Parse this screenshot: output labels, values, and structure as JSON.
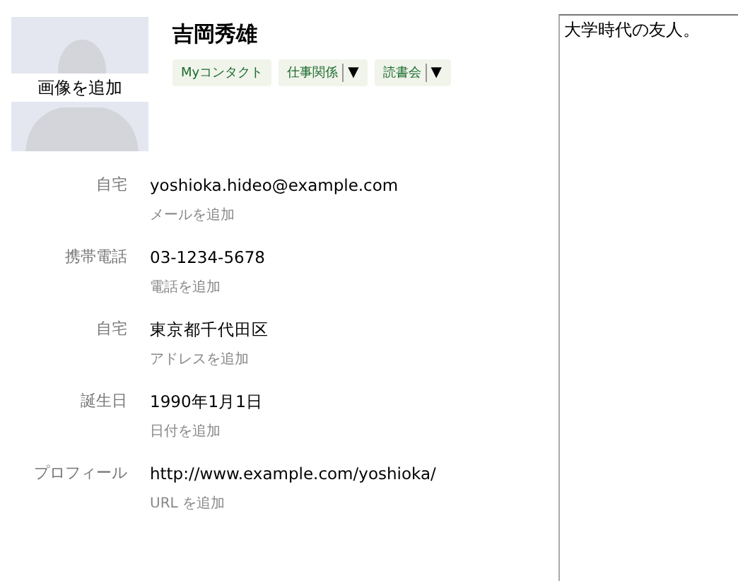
{
  "photo": {
    "label": "画像を追加"
  },
  "name": "吉岡秀雄",
  "groups": [
    {
      "label": "Myコンタクト",
      "menu": false
    },
    {
      "label": "仕事関係",
      "menu": true,
      "menu_glyph": "▼"
    },
    {
      "label": "読書会",
      "menu": true,
      "menu_glyph": "▼"
    }
  ],
  "fields": [
    {
      "label": "自宅",
      "value": "yoshioka.hideo@example.com",
      "add": "メールを追加"
    },
    {
      "label": "携帯電話",
      "value": "03-1234-5678",
      "add": "電話を追加"
    },
    {
      "label": "自宅",
      "value": "東京都千代田区",
      "add": "アドレスを追加"
    },
    {
      "label": "誕生日",
      "value": "1990年1月1日",
      "add": "日付を追加"
    },
    {
      "label": "プロフィール",
      "value": "http://www.example.com/yoshioka/",
      "add": "URL を追加"
    }
  ],
  "notes": {
    "value": "大学時代の友人。"
  }
}
